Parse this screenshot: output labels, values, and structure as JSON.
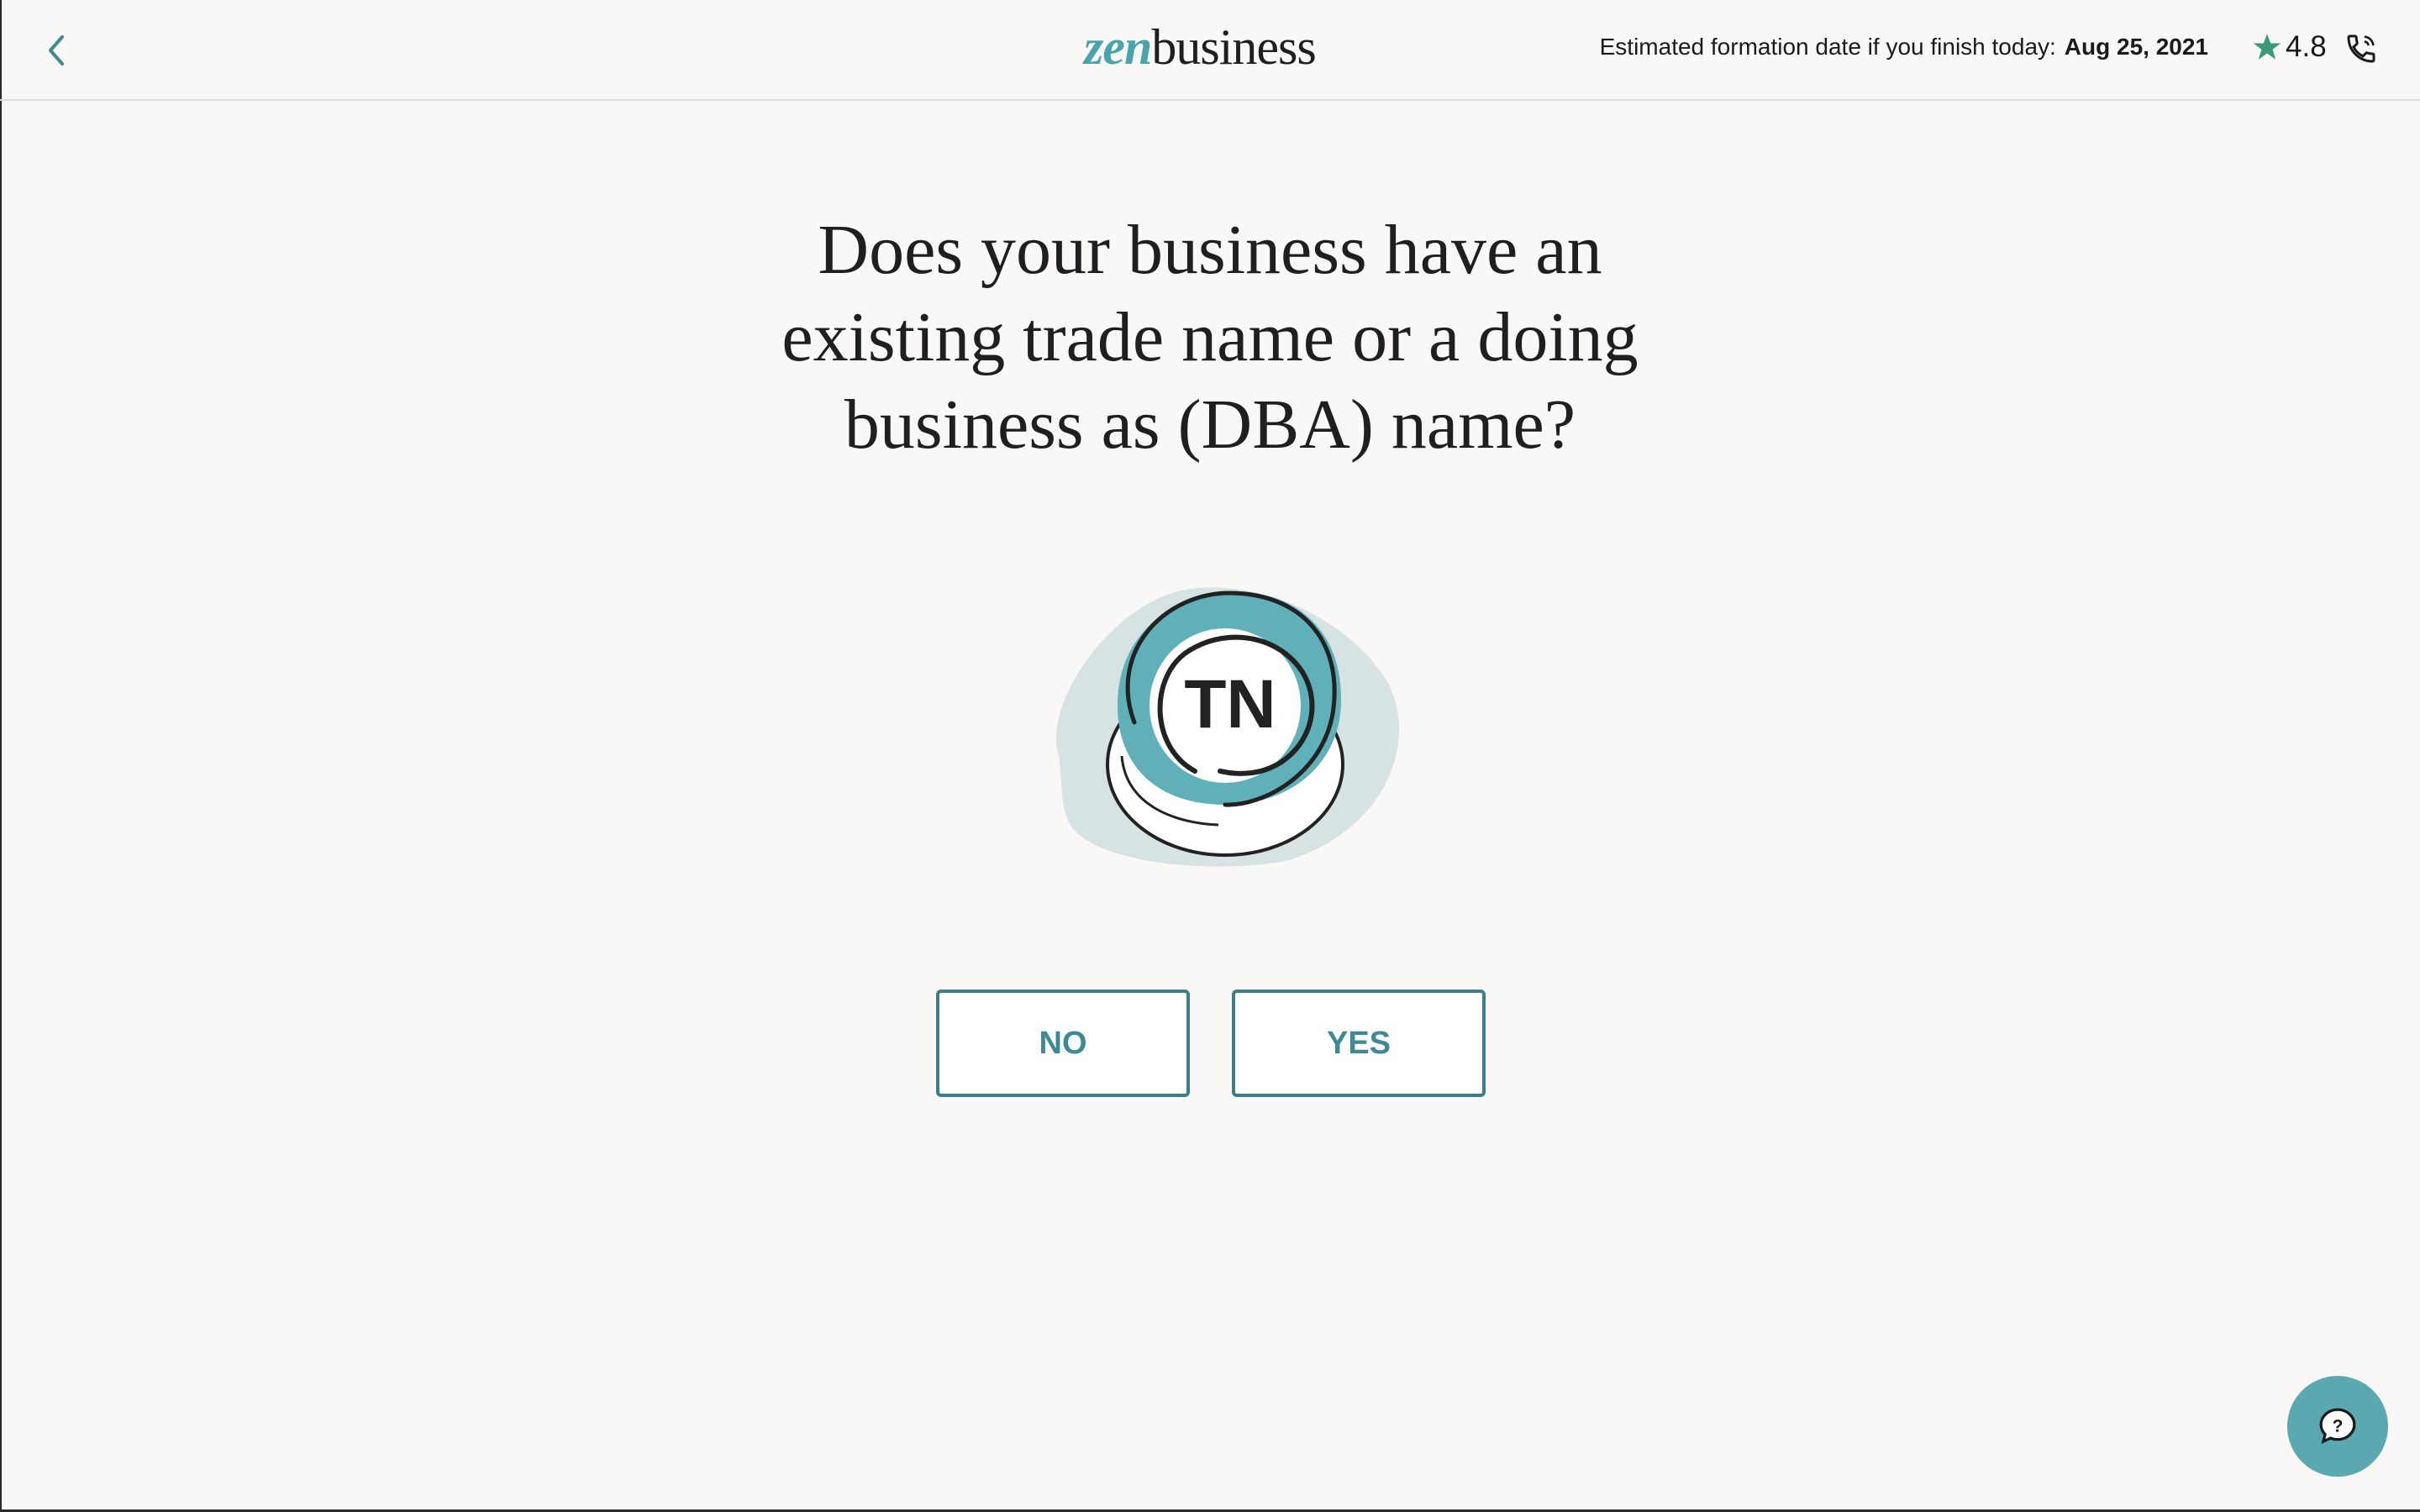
{
  "header": {
    "logo_zen": "zen",
    "logo_business": "business",
    "estimate_label": "Estimated formation date if you finish today:",
    "estimate_date": "Aug 25, 2021",
    "rating": "4.8",
    "back_icon": "chevron-left-icon",
    "star_icon": "star-icon",
    "phone_icon": "phone-icon"
  },
  "main": {
    "question_line1": "Does your business have an",
    "question_line2": "existing trade name or a doing",
    "question_line3": "business as (DBA) name?",
    "illustration_text": "TN",
    "no_label": "NO",
    "yes_label": "YES"
  },
  "help": {
    "icon": "chat-question-icon"
  },
  "colors": {
    "accent": "#4aa4ac",
    "button_border": "#3d7d86",
    "star": "#3a9a76",
    "background": "#f9f8f6"
  }
}
